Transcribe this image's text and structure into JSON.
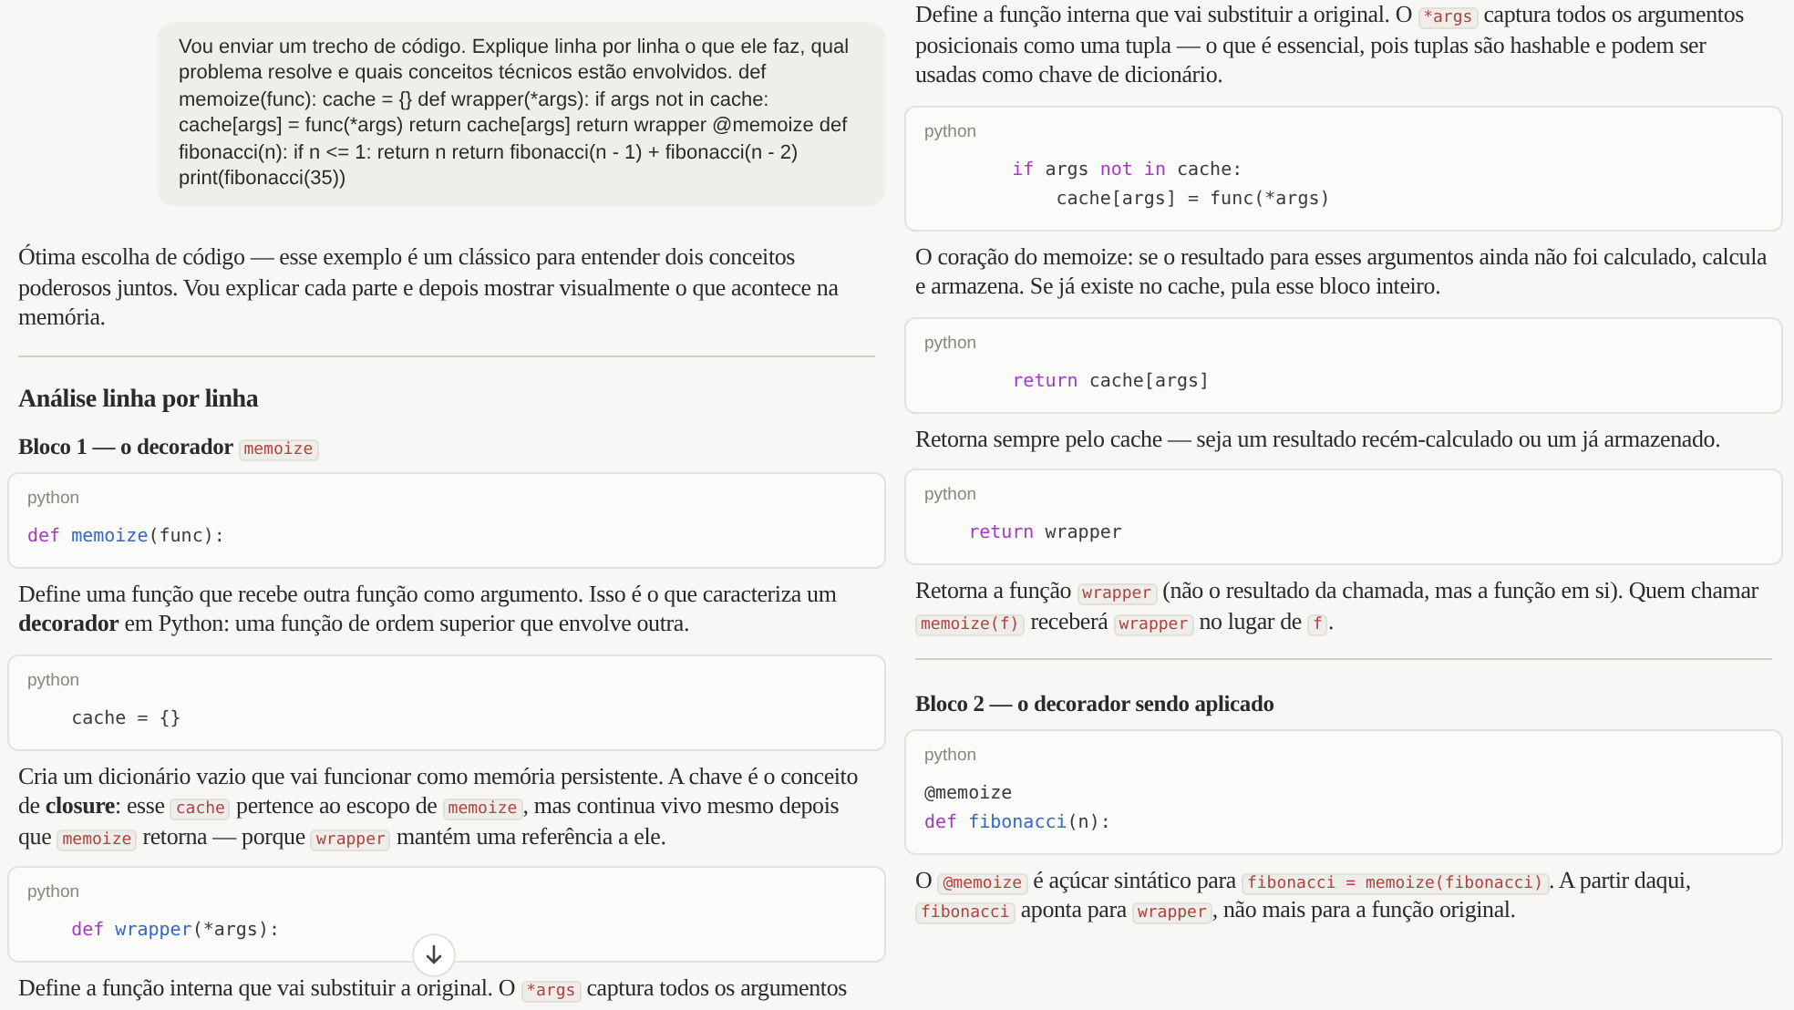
{
  "columns": [
    {
      "blocks": [
        {
          "kind": "user_message",
          "text": "Vou enviar um trecho de código. Explique linha por linha o que ele faz, qual problema resolve e quais conceitos técnicos estão envolvidos. def memoize(func): cache = {} def wrapper(*args): if args not in cache: cache[args] = func(*args) return cache[args] return wrapper @memoize def fibonacci(n): if n <= 1: return n return fibonacci(n - 1) + fibonacci(n - 2) print(fibonacci(35))"
        },
        {
          "kind": "paragraph",
          "parts": [
            {
              "kind": "text",
              "text": "Ótima escolha de código — esse exemplo é um clássico para entender dois conceitos poderosos juntos. Vou explicar cada parte e depois mostrar visualmente o que acontece na memória."
            }
          ]
        },
        {
          "kind": "divider"
        },
        {
          "kind": "heading",
          "parts": [
            {
              "kind": "text",
              "text": "Análise linha por linha"
            }
          ]
        },
        {
          "kind": "subheading",
          "parts": [
            {
              "kind": "text",
              "text": "Bloco 1 — o decorador "
            },
            {
              "kind": "code",
              "text": "memoize"
            }
          ]
        },
        {
          "kind": "code",
          "language": "python",
          "lines": [
            [
              {
                "kind": "keyword",
                "text": "def"
              },
              {
                "kind": "function",
                "text": " memoize"
              },
              {
                "kind": "plain",
                "text": "(func):"
              }
            ]
          ]
        },
        {
          "kind": "paragraph",
          "parts": [
            {
              "kind": "text",
              "text": "Define uma função que recebe outra função como argumento. Isso é o que caracteriza um "
            },
            {
              "kind": "bold",
              "text": "decorador"
            },
            {
              "kind": "text",
              "text": " em Python: uma função de ordem superior que envolve outra."
            }
          ]
        },
        {
          "kind": "code",
          "language": "python",
          "lines": [
            [
              {
                "kind": "plain",
                "text": "    cache = {}"
              }
            ]
          ]
        },
        {
          "kind": "paragraph",
          "parts": [
            {
              "kind": "text",
              "text": "Cria um dicionário vazio que vai funcionar como memória persistente. A chave é o conceito de "
            },
            {
              "kind": "bold",
              "text": "closure"
            },
            {
              "kind": "text",
              "text": ": esse "
            },
            {
              "kind": "code",
              "text": "cache"
            },
            {
              "kind": "text",
              "text": " pertence ao escopo de "
            },
            {
              "kind": "code",
              "text": "memoize"
            },
            {
              "kind": "text",
              "text": ", mas continua vivo mesmo depois que "
            },
            {
              "kind": "code",
              "text": "memoize"
            },
            {
              "kind": "text",
              "text": " retorna — porque "
            },
            {
              "kind": "code",
              "text": "wrapper"
            },
            {
              "kind": "text",
              "text": " mantém uma referência a ele."
            }
          ]
        },
        {
          "kind": "code",
          "language": "python",
          "lines": [
            [
              {
                "kind": "keyword",
                "text": "    def"
              },
              {
                "kind": "function",
                "text": " wrapper"
              },
              {
                "kind": "plain",
                "text": "(*args):"
              }
            ]
          ]
        },
        {
          "kind": "paragraph",
          "parts": [
            {
              "kind": "text",
              "text": "Define a função interna que vai substituir a original. O "
            },
            {
              "kind": "code",
              "text": "*args"
            },
            {
              "kind": "text",
              "text": " captura todos os argumentos"
            }
          ]
        }
      ]
    },
    {
      "blocks": [
        {
          "kind": "paragraph",
          "parts": [
            {
              "kind": "text",
              "text": "Define a função interna que vai substituir a original. O "
            },
            {
              "kind": "code",
              "text": "*args"
            },
            {
              "kind": "text",
              "text": " captura todos os argumentos posicionais como uma tupla — o que é essencial, pois tuplas são hashable e podem ser usadas como chave de dicionário."
            }
          ]
        },
        {
          "kind": "code",
          "language": "python",
          "lines": [
            [
              {
                "kind": "keyword",
                "text": "        if"
              },
              {
                "kind": "plain",
                "text": " args "
              },
              {
                "kind": "keyword",
                "text": "not in"
              },
              {
                "kind": "plain",
                "text": " cache:"
              }
            ],
            [
              {
                "kind": "plain",
                "text": "            cache[args] = func(*args)"
              }
            ]
          ]
        },
        {
          "kind": "paragraph",
          "parts": [
            {
              "kind": "text",
              "text": "O coração do memoize: se o resultado para esses argumentos ainda não foi calculado, calcula e armazena. Se já existe no cache, pula esse bloco inteiro."
            }
          ]
        },
        {
          "kind": "code",
          "language": "python",
          "lines": [
            [
              {
                "kind": "keyword",
                "text": "        return"
              },
              {
                "kind": "plain",
                "text": " cache[args]"
              }
            ]
          ]
        },
        {
          "kind": "paragraph",
          "parts": [
            {
              "kind": "text",
              "text": "Retorna sempre pelo cache — seja um resultado recém-calculado ou um já armazenado."
            }
          ]
        },
        {
          "kind": "code",
          "language": "python",
          "lines": [
            [
              {
                "kind": "keyword",
                "text": "    return"
              },
              {
                "kind": "plain",
                "text": " wrapper"
              }
            ]
          ]
        },
        {
          "kind": "paragraph",
          "parts": [
            {
              "kind": "text",
              "text": "Retorna a função "
            },
            {
              "kind": "code",
              "text": "wrapper"
            },
            {
              "kind": "text",
              "text": " (não o resultado da chamada, mas a função em si). Quem chamar "
            },
            {
              "kind": "code",
              "text": "memoize(f)"
            },
            {
              "kind": "text",
              "text": " receberá "
            },
            {
              "kind": "code",
              "text": "wrapper"
            },
            {
              "kind": "text",
              "text": " no lugar de "
            },
            {
              "kind": "code",
              "text": "f"
            },
            {
              "kind": "text",
              "text": "."
            }
          ]
        },
        {
          "kind": "divider"
        },
        {
          "kind": "subheading",
          "parts": [
            {
              "kind": "text",
              "text": "Bloco 2 — o decorador sendo aplicado"
            }
          ]
        },
        {
          "kind": "code",
          "language": "python",
          "lines": [
            [
              {
                "kind": "plain",
                "text": "@memoize"
              }
            ],
            [
              {
                "kind": "keyword",
                "text": "def"
              },
              {
                "kind": "function",
                "text": " fibonacci"
              },
              {
                "kind": "plain",
                "text": "(n):"
              }
            ]
          ]
        },
        {
          "kind": "paragraph",
          "parts": [
            {
              "kind": "text",
              "text": "O "
            },
            {
              "kind": "code",
              "text": "@memoize"
            },
            {
              "kind": "text",
              "text": " é açúcar sintático para "
            },
            {
              "kind": "code",
              "text": "fibonacci = memoize(fibonacci)"
            },
            {
              "kind": "text",
              "text": ". A partir daqui, "
            },
            {
              "kind": "code",
              "text": "fibonacci"
            },
            {
              "kind": "text",
              "text": " aponta para "
            },
            {
              "kind": "code",
              "text": "wrapper"
            },
            {
              "kind": "text",
              "text": ", não mais para a função original."
            }
          ]
        }
      ]
    }
  ]
}
